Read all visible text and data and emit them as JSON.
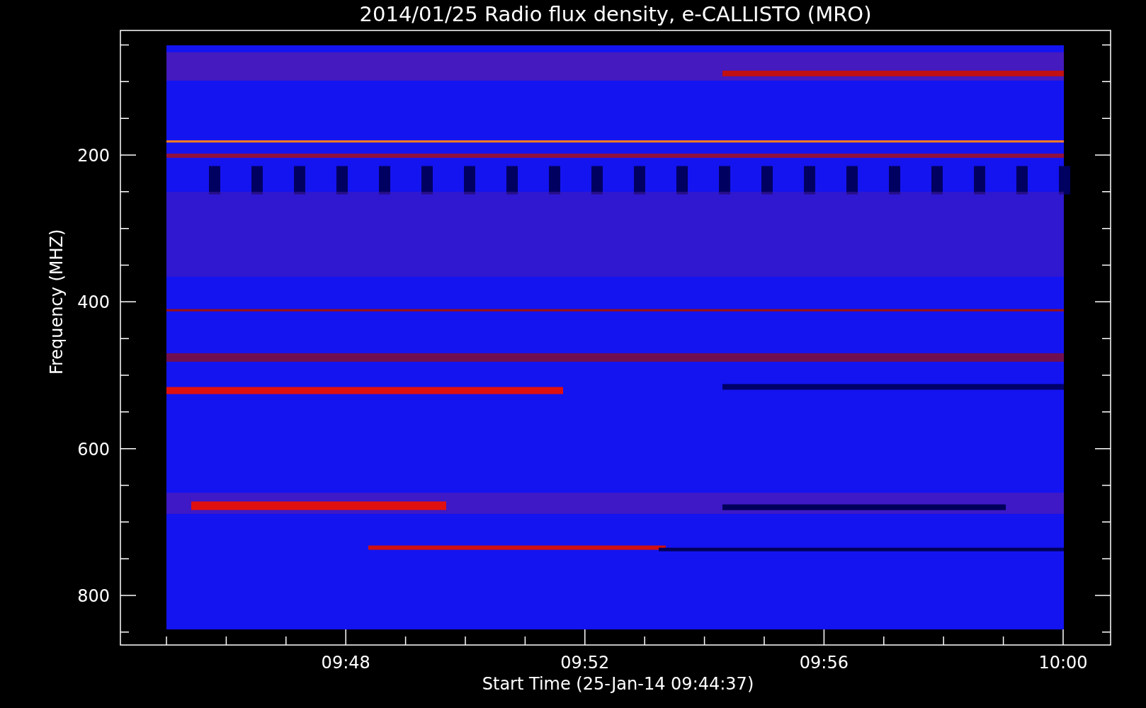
{
  "plot": {
    "title": "2014/01/25  Radio flux density, e-CALLISTO (MRO)",
    "ylabel": "Frequency (MHZ)",
    "xlabel": "Start Time (25-Jan-14 09:44:37)",
    "yticks": [
      "200",
      "400",
      "600",
      "800"
    ],
    "xticks": [
      "09:48",
      "09:52",
      "09:56",
      "10:00"
    ]
  }
}
